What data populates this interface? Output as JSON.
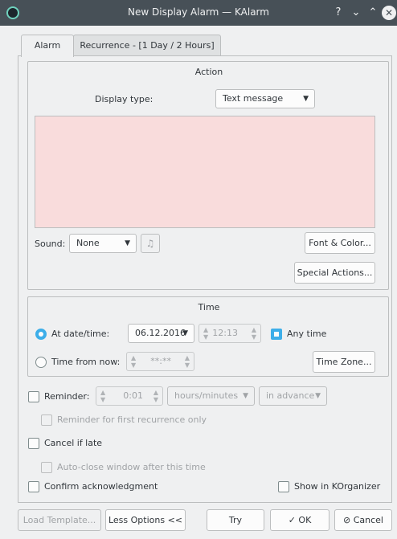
{
  "window": {
    "title": "New Display Alarm — KAlarm",
    "help_icon": "?",
    "minimize_icon": "⌄",
    "maximize_icon": "⌃",
    "close_icon": "✕"
  },
  "tabs": [
    {
      "label": "Alarm",
      "active": true
    },
    {
      "label": "Recurrence - [1 Day / 2 Hours]",
      "active": false
    }
  ],
  "action": {
    "title": "Action",
    "display_type_label": "Display type:",
    "display_type_value": "Text message",
    "message_text": "",
    "message_bg_color": "#f9dcdc",
    "sound_label": "Sound:",
    "sound_value": "None",
    "sound_file_icon": "music-note-icon",
    "font_color_button": "Font & Color...",
    "special_actions_button": "Special Actions..."
  },
  "time": {
    "title": "Time",
    "at_datetime_label": "At date/time:",
    "at_datetime_selected": true,
    "date_value": "06.12.2016",
    "time_value": "12:13",
    "any_time_label": "Any time",
    "any_time_checked": true,
    "time_from_now_label": "Time from now:",
    "time_from_now_value": "**:**",
    "time_zone_button": "Time Zone..."
  },
  "reminder": {
    "label": "Reminder:",
    "checked": false,
    "value": "0:01",
    "units": "hours/minutes",
    "when": "in advance",
    "first_recurrence_label": "Reminder for first recurrence only"
  },
  "cancel_if_late": {
    "label": "Cancel if late",
    "checked": false,
    "auto_close_label": "Auto-close window after this time"
  },
  "confirm_ack_label": "Confirm acknowledgment",
  "show_in_korganizer_label": "Show in KOrganizer",
  "footer": {
    "load_template": "Load Template...",
    "less_options": "Less Options <<",
    "try": "Try",
    "ok": "OK",
    "cancel": "Cancel"
  },
  "colors": {
    "accent": "#3daee9",
    "titlebar": "#475057",
    "window_bg": "#eff0f1"
  }
}
